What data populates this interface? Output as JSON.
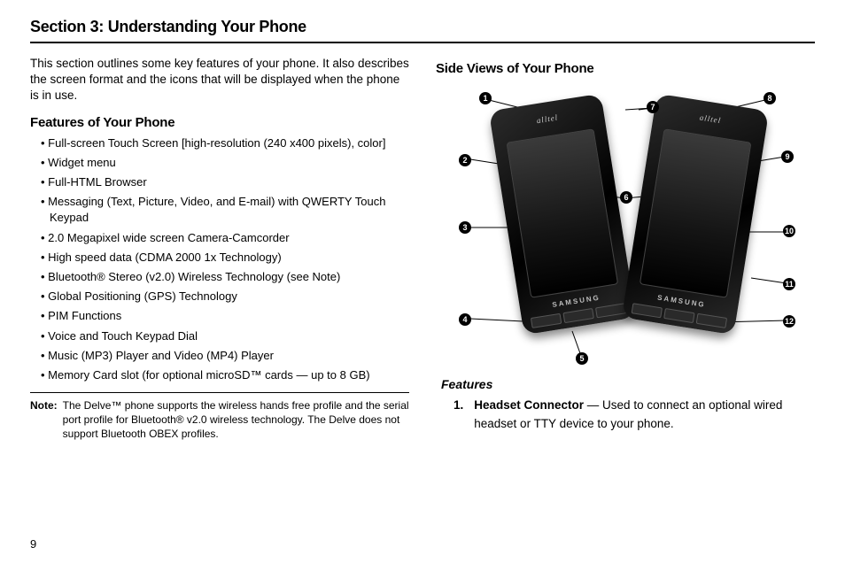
{
  "section_title": "Section 3: Understanding Your Phone",
  "intro": "This section outlines some key features of your phone. It also describes the screen format and the icons that will be displayed when the phone is in use.",
  "features_heading": "Features of Your Phone",
  "features": [
    "Full-screen Touch Screen [high-resolution (240 x400 pixels), color]",
    "Widget menu",
    "Full-HTML Browser",
    "Messaging (Text, Picture, Video, and E-mail) with QWERTY Touch Keypad",
    "2.0 Megapixel wide screen Camera-Camcorder",
    "High speed data (CDMA 2000 1x Technology)",
    "Bluetooth® Stereo (v2.0) Wireless Technology (see Note)",
    "Global Positioning (GPS) Technology",
    "PIM Functions",
    "Voice and Touch Keypad Dial",
    "Music (MP3) Player and Video (MP4) Player",
    " Memory Card slot (for optional microSD™ cards — up to 8 GB)"
  ],
  "note_label": "Note:",
  "note_text": "The Delve™ phone supports the wireless hands free profile and the serial port profile for Bluetooth® v2.0 wireless technology. The Delve does not support Bluetooth OBEX profiles.",
  "side_views_heading": "Side Views of Your Phone",
  "phone_brand_top": "alltel",
  "phone_brand_bottom": "SAMSUNG",
  "callouts": [
    "1",
    "2",
    "3",
    "4",
    "5",
    "6",
    "7",
    "8",
    "9",
    "10",
    "11",
    "12"
  ],
  "features_subhead": "Features",
  "numbered": {
    "n": "1.",
    "bold": "Headset Connector",
    "text": " — Used to connect an optional wired headset or TTY device to your phone."
  },
  "page_number": "9"
}
